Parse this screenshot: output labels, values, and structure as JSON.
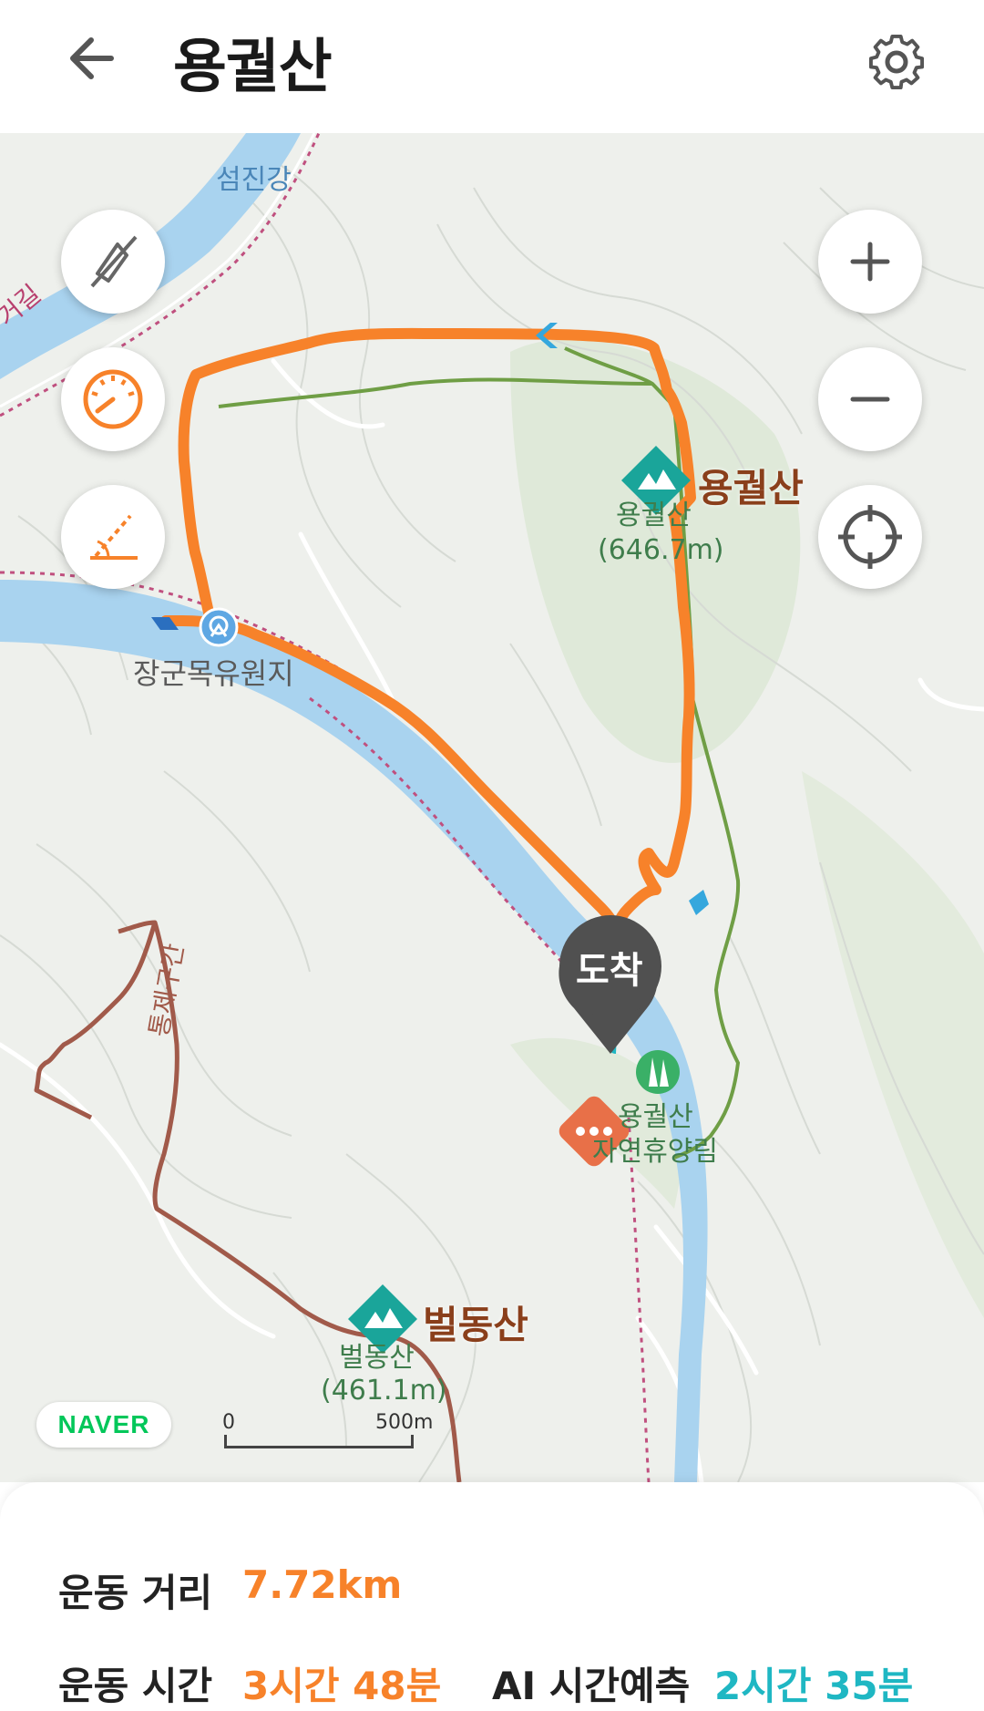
{
  "header": {
    "title": "용궐산",
    "back_icon": "arrow-left-icon",
    "settings_icon": "gear-icon"
  },
  "map": {
    "labels": {
      "river_name": "섬진강",
      "trail_partial": "거길",
      "summit_main_name": "용궐산",
      "summit_main_caption": "용궐산",
      "summit_main_elev": "(646.7m)",
      "recreation_area": "장군목유원지",
      "arrival_marker": "도착",
      "forest_name_1": "용궐산",
      "forest_name_2": "자연휴양림",
      "restricted_section": "통제구간",
      "summit_second_name": "벌동산",
      "summit_second_caption": "벌동산",
      "summit_second_elev": "(461.1m)"
    },
    "controls": {
      "compass_icon": "compass-off-icon",
      "speed_icon": "speedometer-icon",
      "slope_icon": "slope-icon",
      "zoom_in_icon": "plus-icon",
      "zoom_out_icon": "minus-icon",
      "locate_icon": "crosshair-icon"
    },
    "logo": "NAVER",
    "scale": {
      "start": "0",
      "end": "500m"
    },
    "colors": {
      "route": "#f7822a",
      "trail": "#6f9e45",
      "river": "#a9d3ef",
      "summit": "#1aa59a",
      "restricted_trail": "#a15a4a"
    }
  },
  "stats": {
    "distance_label": "운동 거리",
    "distance_value": "7.72km",
    "time_label": "운동 시간",
    "time_value": "3시간 48분",
    "ai_label": "AI 시간예측",
    "ai_value": "2시간 35분",
    "accent_orange": "#f7822a",
    "accent_teal": "#1fb7c3"
  }
}
